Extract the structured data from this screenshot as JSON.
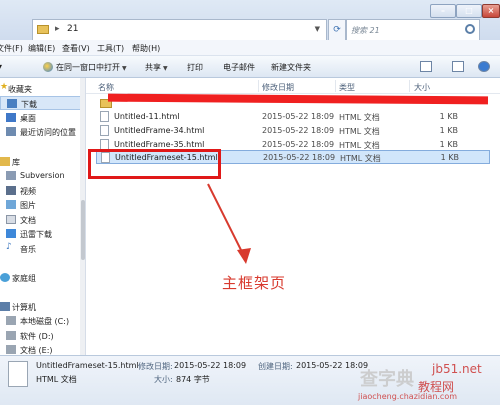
{
  "address": {
    "path": "21",
    "search_placeholder": "搜索 21"
  },
  "menu": [
    "文件(F)",
    "编辑(E)",
    "查看(V)",
    "工具(T)",
    "帮助(H)"
  ],
  "toolbar": {
    "open_with": "在同一窗口中打开",
    "share": "共享",
    "print": "打印",
    "email": "电子邮件",
    "new_folder": "新建文件夹"
  },
  "sidebar": {
    "favorites": "收藏夹",
    "downloads": "下载",
    "desktop": "桌面",
    "recent": "最近访问的位置",
    "libraries": "库",
    "subversion": "Subversion",
    "videos": "视频",
    "pictures": "图片",
    "documents": "文档",
    "xunlei": "迅雷下载",
    "music": "音乐",
    "homegroup": "家庭组",
    "computer": "计算机",
    "drive_c": "本地磁盘 (C:)",
    "drive_d": "软件 (D:)",
    "drive_e": "文档 (E:)"
  },
  "columns": {
    "name": "名称",
    "date": "修改日期",
    "type": "类型",
    "size": "大小"
  },
  "files": [
    {
      "name": "Untitled-11.html",
      "date": "2015-05-22 18:09",
      "type": "HTML 文档",
      "size": "1 KB"
    },
    {
      "name": "UntitledFrame-34.html",
      "date": "2015-05-22 18:09",
      "type": "HTML 文档",
      "size": "1 KB"
    },
    {
      "name": "UntitledFrame-35.html",
      "date": "2015-05-22 18:09",
      "type": "HTML 文档",
      "size": "1 KB"
    },
    {
      "name": "UntitledFrameset-15.html",
      "date": "2015-05-22 18:09",
      "type": "HTML 文档",
      "size": "1 KB"
    }
  ],
  "annotation": "主框架页",
  "details": {
    "filename": "UntitledFrameset-15.html",
    "filetype": "HTML 文档",
    "modified_label": "修改日期:",
    "modified_value": "2015-05-22 18:09",
    "created_label": "创建日期:",
    "created_value": "2015-05-22 18:09",
    "size_label": "大小:",
    "size_value": "874 字节"
  },
  "watermark": {
    "brand": "查字典",
    "tutorial": "教程网",
    "site": "jb51.net",
    "url": "jiaocheng.chazidian.com"
  }
}
